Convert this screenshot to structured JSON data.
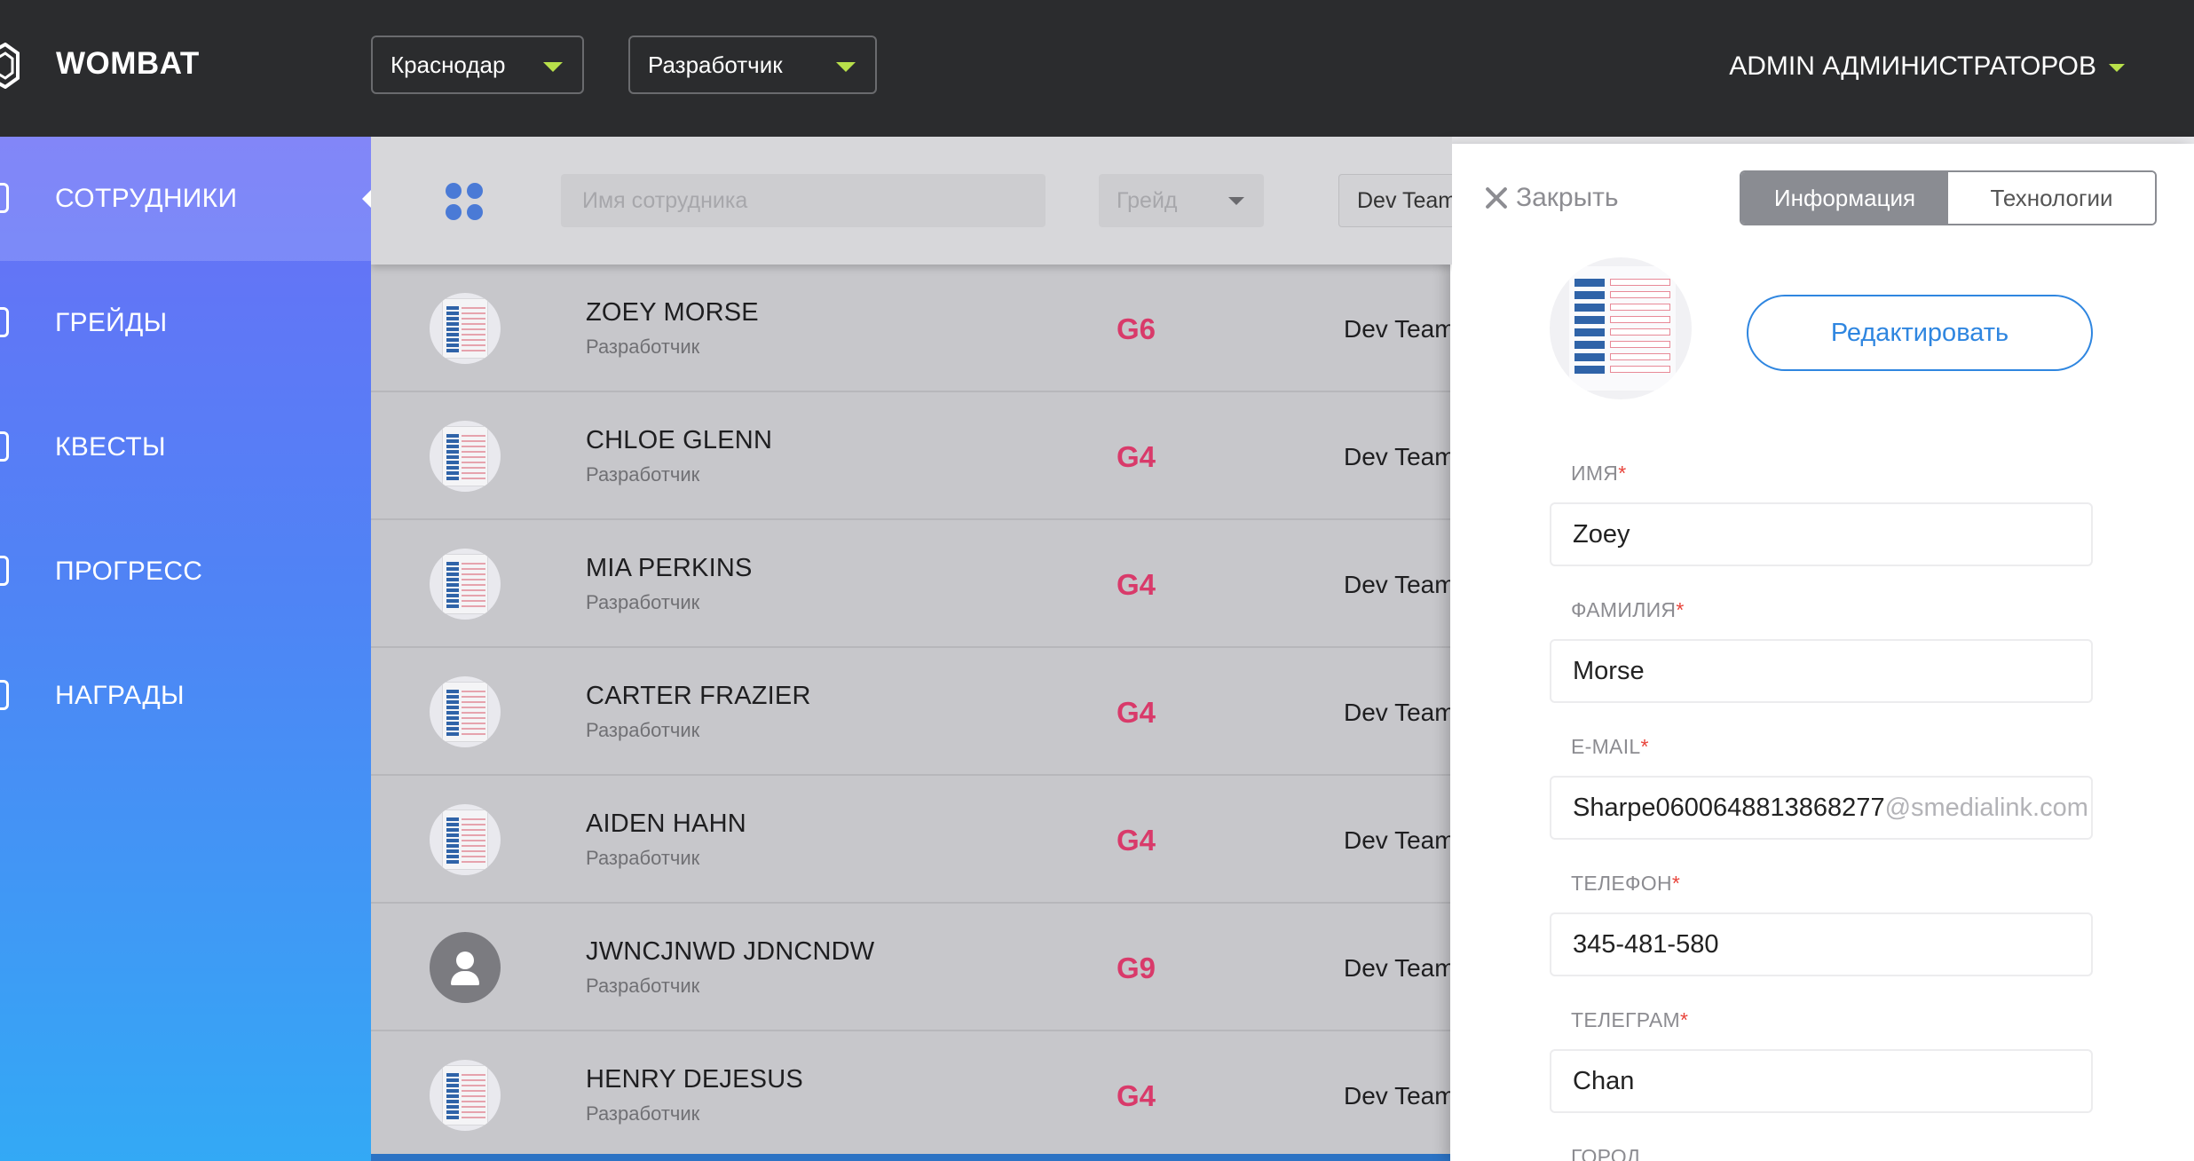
{
  "header": {
    "brand": "WOMBAT",
    "city_select": "Краснодар",
    "role_select": "Разработчик",
    "user_menu": "ADMIN АДМИНИСТРАТОРОВ",
    "accent_color": "#b8e04a"
  },
  "sidebar": {
    "items": [
      {
        "label": "СОТРУДНИКИ",
        "icon": "users-icon",
        "active": true
      },
      {
        "label": "ГРЕЙДЫ",
        "icon": "list-icon"
      },
      {
        "label": "КВЕСТЫ",
        "icon": "quest-icon"
      },
      {
        "label": "ПРОГРЕСС",
        "icon": "chart-icon"
      },
      {
        "label": "НАГРАДЫ",
        "icon": "award-icon"
      }
    ]
  },
  "filters": {
    "search_placeholder": "Имя сотрудника",
    "grade_placeholder": "Грейд",
    "team_value": "Dev Team"
  },
  "employees": [
    {
      "name": "ZOEY MORSE",
      "role": "Разработчик",
      "grade": "G6",
      "team": "Dev Team",
      "avatar": "document"
    },
    {
      "name": "CHLOE GLENN",
      "role": "Разработчик",
      "grade": "G4",
      "team": "Dev Team",
      "avatar": "document"
    },
    {
      "name": "MIA PERKINS",
      "role": "Разработчик",
      "grade": "G4",
      "team": "Dev Team",
      "avatar": "document"
    },
    {
      "name": "CARTER FRAZIER",
      "role": "Разработчик",
      "grade": "G4",
      "team": "Dev Team",
      "avatar": "document"
    },
    {
      "name": "AIDEN HAHN",
      "role": "Разработчик",
      "grade": "G4",
      "team": "Dev Team",
      "avatar": "document"
    },
    {
      "name": "JWNCJNWD JDNCNDW",
      "role": "Разработчик",
      "grade": "G9",
      "team": "Dev Team",
      "avatar": "default"
    },
    {
      "name": "HENRY DEJESUS",
      "role": "Разработчик",
      "grade": "G4",
      "team": "Dev Team",
      "avatar": "document"
    }
  ],
  "panel": {
    "close_label": "Закрыть",
    "tabs": [
      "Информация",
      "Технологии"
    ],
    "active_tab": 0,
    "edit_label": "Редактировать",
    "fields": {
      "first_name": {
        "label": "ИМЯ",
        "value": "Zoey"
      },
      "last_name": {
        "label": "ФАМИЛИЯ",
        "value": "Morse"
      },
      "email": {
        "label": "E-MAIL",
        "value": "Sharpe0600648813868277",
        "domain": "@smedialink.com"
      },
      "phone": {
        "label": "ТЕЛЕФОН",
        "value": "345-481-580"
      },
      "telegram": {
        "label": "ТЕЛЕГРАМ",
        "value": "Chan"
      },
      "city": {
        "label": "ГОРОД"
      }
    },
    "required_mark": "*"
  }
}
